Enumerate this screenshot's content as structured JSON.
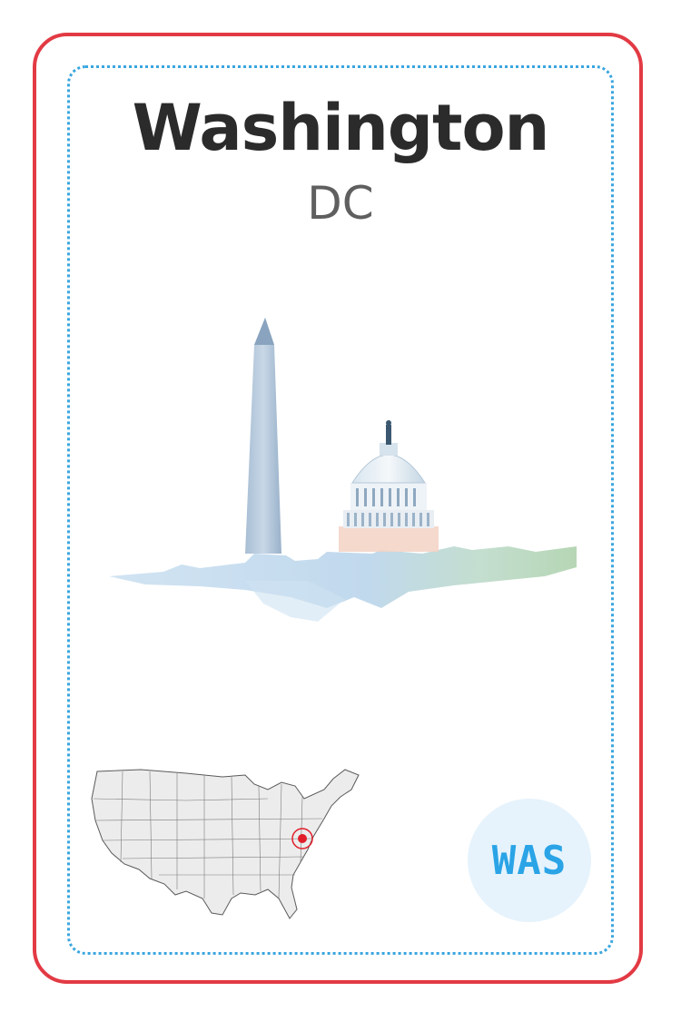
{
  "card": {
    "city": "Washington",
    "region": "DC",
    "code": "WAS"
  },
  "illustration": {
    "subjects": [
      "washington-monument",
      "us-capitol"
    ]
  },
  "map": {
    "country": "USA",
    "marker_color": "#e11d2a"
  },
  "colors": {
    "border": "#e23a44",
    "dotted_border": "#3aa6df",
    "badge_bg": "#e6f3fc",
    "badge_text": "#2aa4e6"
  }
}
